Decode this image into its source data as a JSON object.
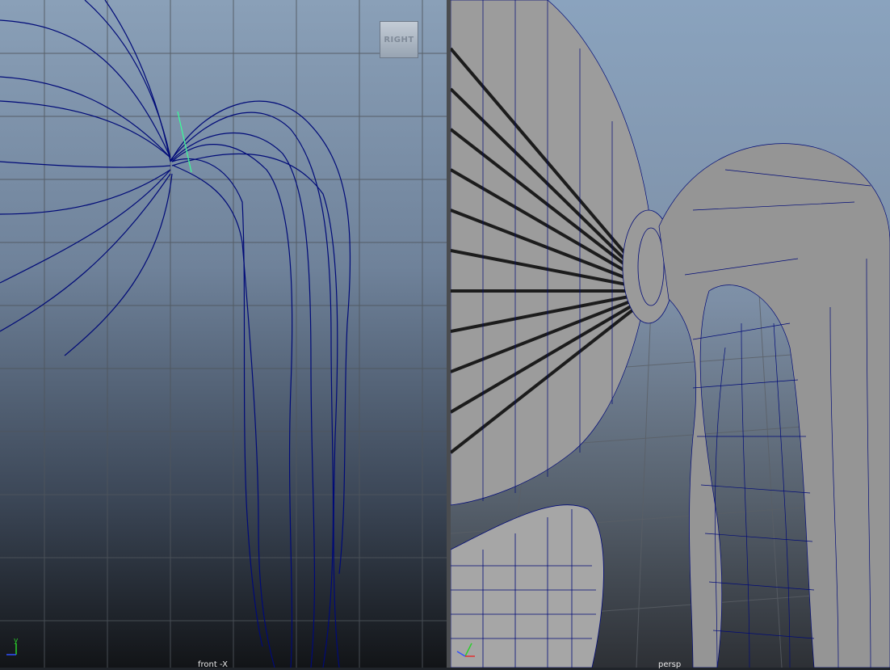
{
  "viewports": {
    "left": {
      "camera_label": "front -X",
      "view_cube_label": "RIGHT"
    },
    "right": {
      "camera_label": "persp"
    }
  },
  "colors": {
    "curve": "#000080",
    "grid_line": "#4e5258",
    "mesh_fill": "#9a9a9a",
    "mesh_wire": "#000080",
    "selection_highlight": "#38ff9a"
  }
}
